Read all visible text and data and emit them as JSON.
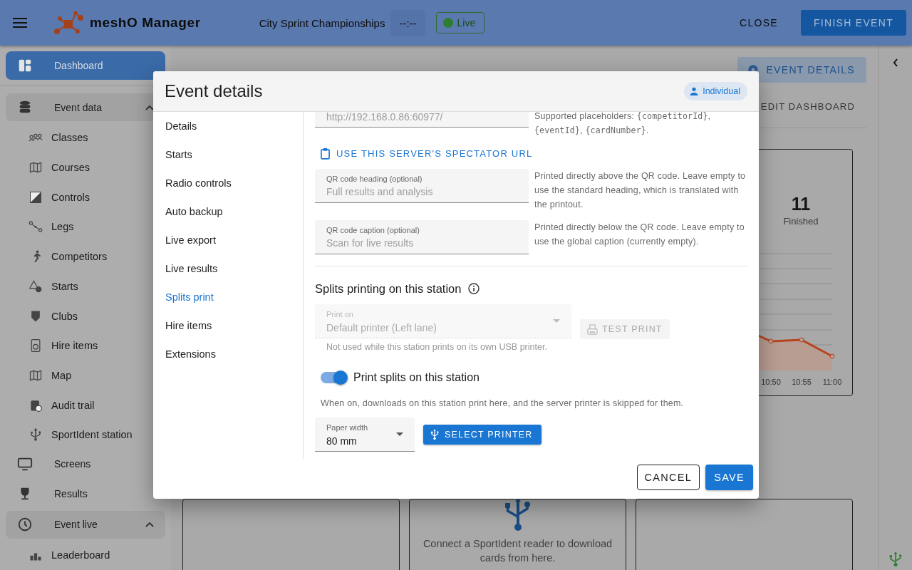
{
  "app_bar": {
    "product": "meshO Manager",
    "event_name": "City Sprint Championships",
    "clock": "--:--",
    "status": {
      "label": "Live",
      "live": true
    },
    "actions": [
      {
        "label": "CLOSE",
        "kind": "text"
      },
      {
        "label": "FINISH EVENT",
        "kind": "primary"
      }
    ]
  },
  "sidebar": [
    {
      "label": "Dashboard",
      "kind": "link",
      "selected": true
    },
    {
      "label": "Event data",
      "kind": "group",
      "selected": false,
      "expanded": true,
      "children": [
        {
          "label": "Classes",
          "selected": false
        },
        {
          "label": "Courses",
          "selected": false
        },
        {
          "label": "Controls",
          "selected": false
        },
        {
          "label": "Legs",
          "selected": false
        },
        {
          "label": "Competitors",
          "selected": false
        },
        {
          "label": "Starts",
          "selected": false
        },
        {
          "label": "Clubs",
          "selected": false
        },
        {
          "label": "Hire items",
          "selected": false
        },
        {
          "label": "Map",
          "selected": false
        },
        {
          "label": "Audit trail",
          "selected": false
        },
        {
          "label": "SportIdent station",
          "selected": false
        }
      ]
    },
    {
      "label": "Screens",
      "kind": "link",
      "selected": false
    },
    {
      "label": "Results",
      "kind": "link",
      "selected": false
    },
    {
      "label": "Event live",
      "kind": "group",
      "selected": false,
      "expanded": true,
      "children": [
        {
          "label": "Leaderboard",
          "selected": false
        }
      ]
    }
  ],
  "main": {
    "event_details_button": "EVENT DETAILS",
    "edit_dashboard_button": "EDIT DASHBOARD",
    "stat": {
      "value": "11",
      "label": "Finished"
    },
    "chart": {
      "x_labels": [
        "10:50",
        "10:55",
        "11:00"
      ]
    },
    "reader_card": {
      "text": "Connect a SportIdent reader to download cards from here."
    }
  },
  "dialog": {
    "title": "Event details",
    "badge": "Individual",
    "nav": [
      {
        "label": "Details",
        "selected": false
      },
      {
        "label": "Starts",
        "selected": false
      },
      {
        "label": "Radio controls",
        "selected": false
      },
      {
        "label": "Auto backup",
        "selected": false
      },
      {
        "label": "Live export",
        "selected": false
      },
      {
        "label": "Live results",
        "selected": false
      },
      {
        "label": "Splits print",
        "selected": true
      },
      {
        "label": "Hire items",
        "selected": false
      },
      {
        "label": "Extensions",
        "selected": false
      }
    ],
    "url_field": {
      "placeholder": "http://192.168.0.86:60977/",
      "help": [
        {
          "kind": "plain",
          "text": "Supported placeholders: "
        },
        {
          "kind": "code",
          "text": "{competitorId}"
        },
        {
          "kind": "plain",
          "text": ", "
        },
        {
          "kind": "code",
          "text": "{eventId}"
        },
        {
          "kind": "plain",
          "text": ", "
        },
        {
          "kind": "code",
          "text": "{cardNumber}"
        },
        {
          "kind": "plain",
          "text": "."
        }
      ]
    },
    "spectator_url_button": "USE THIS SERVER'S SPECTATOR URL",
    "qr_fields": [
      {
        "label": "QR code heading (optional)",
        "placeholder": "Full results and analysis",
        "help": "Printed directly above the QR code. Leave empty to use the standard heading, which is translated with the printout."
      },
      {
        "label": "QR code caption (optional)",
        "placeholder": "Scan for live results",
        "help": "Printed directly below the QR code. Leave empty to use the global caption (currently empty)."
      }
    ],
    "splits_section": {
      "heading": "Splits printing on this station",
      "print_on": {
        "label": "Print on",
        "value": "Default printer (Left lane)",
        "hint": "Not used while this station prints on its own USB printer.",
        "disabled": true
      },
      "test_print_button": {
        "label": "TEST PRINT",
        "disabled": true
      },
      "print_switch": {
        "label": "Print splits on this station",
        "on": true
      },
      "switch_hint": "When on, downloads on this station print here, and the server printer is skipped for them.",
      "paper_width": {
        "label": "Paper width",
        "value": "80 mm"
      },
      "select_printer_button": "SELECT PRINTER"
    },
    "buttons": [
      {
        "label": "CANCEL",
        "kind": "outlined"
      },
      {
        "label": "SAVE",
        "kind": "primary"
      }
    ]
  }
}
